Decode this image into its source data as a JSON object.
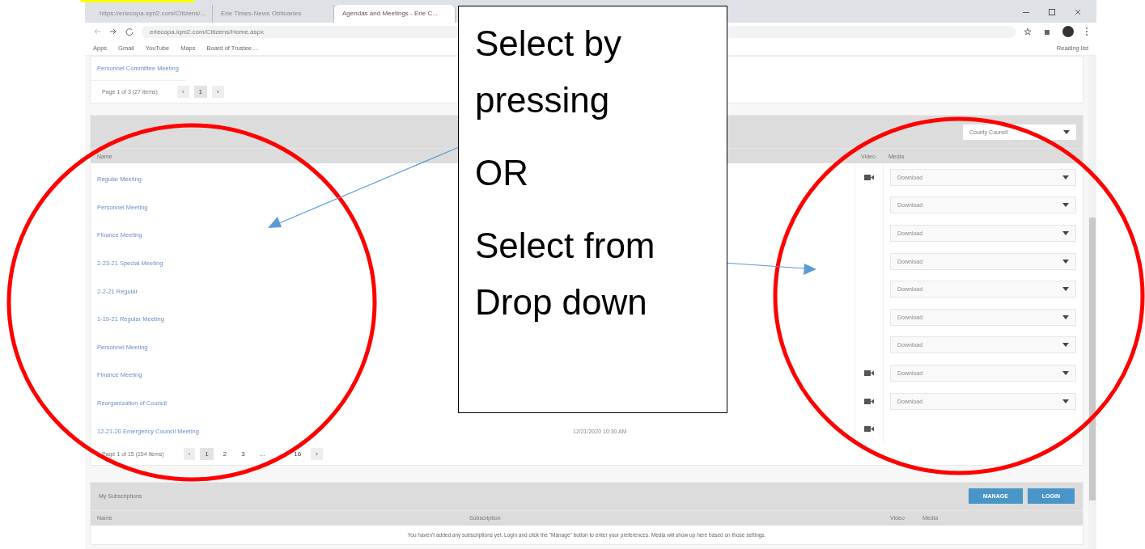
{
  "browser": {
    "tabs": [
      {
        "title": "https://eriecopa.iqm2.com/Citizens/...",
        "selected": false
      },
      {
        "title": "Erie Times-News Obituaries",
        "selected": false
      },
      {
        "title": "Agendas and Meetings - Erie C...",
        "selected": true
      }
    ],
    "address": "eriecopa.iqm2.com/Citizens/Home.aspx",
    "bookmarks": [
      {
        "label": "Apps"
      },
      {
        "label": "Gmail"
      },
      {
        "label": "YouTube"
      },
      {
        "label": "Maps"
      },
      {
        "label": "Board of Trustee ..."
      }
    ],
    "reading_list": "Reading list"
  },
  "previous_list": {
    "rows": [
      "Personnel Committee Meeting"
    ],
    "pager": {
      "summary": "Page 1 of 3 (27 items)",
      "prev": "‹",
      "next": "›",
      "pages": [
        {
          "label": "1",
          "selected": true
        }
      ]
    }
  },
  "meetings": {
    "filter": "County Council",
    "columns": [
      "Name",
      "Video",
      "Media"
    ],
    "rows": [
      {
        "name": "Regular Meeting",
        "video": true,
        "media": "Download"
      },
      {
        "name": "Personnel Meeting",
        "video": false,
        "media": "Download"
      },
      {
        "name": "Finance Meeting",
        "video": false,
        "media": "Download"
      },
      {
        "name": "2-23-21 Special Meeting",
        "video": false,
        "media": "Download"
      },
      {
        "name": "2-2-21 Regular",
        "video": false,
        "media": "Download"
      },
      {
        "name": "1-19-21 Regular Meeting",
        "video": false,
        "media": "Download"
      },
      {
        "name": "Personnel Meeting",
        "video": false,
        "media": "Download"
      },
      {
        "name": "Finance Meeting",
        "video": true,
        "media": "Download"
      },
      {
        "name": "Reorganization of Council",
        "video": true,
        "media": "Download"
      },
      {
        "name": "12-21-20 Emergency Council Meeting",
        "date": "12/21/2020 10:30 AM",
        "video": true
      }
    ],
    "pager": {
      "summary": "Page 1 of 15 (154 items)",
      "prev": "‹",
      "next": "›",
      "pages": [
        {
          "label": "1",
          "selected": true
        },
        {
          "label": "2",
          "selected": false
        },
        {
          "label": "3",
          "selected": false
        },
        {
          "label": "...",
          "selected": false
        },
        {
          "label": "16",
          "selected": false
        }
      ]
    }
  },
  "subscriptions": {
    "title": "My Subscriptions",
    "buttons": [
      "MANAGE",
      "LOGIN"
    ],
    "columns": [
      "Name",
      "Subscription",
      "Video",
      "Media"
    ],
    "message": "You haven't added any subscriptions yet. Login and click the \"Manage\" button to enter your preferences. Media will show up here based on those settings."
  },
  "annotation": {
    "lines": [
      "Select by",
      "pressing",
      "OR",
      "Select from",
      "Drop down"
    ]
  }
}
